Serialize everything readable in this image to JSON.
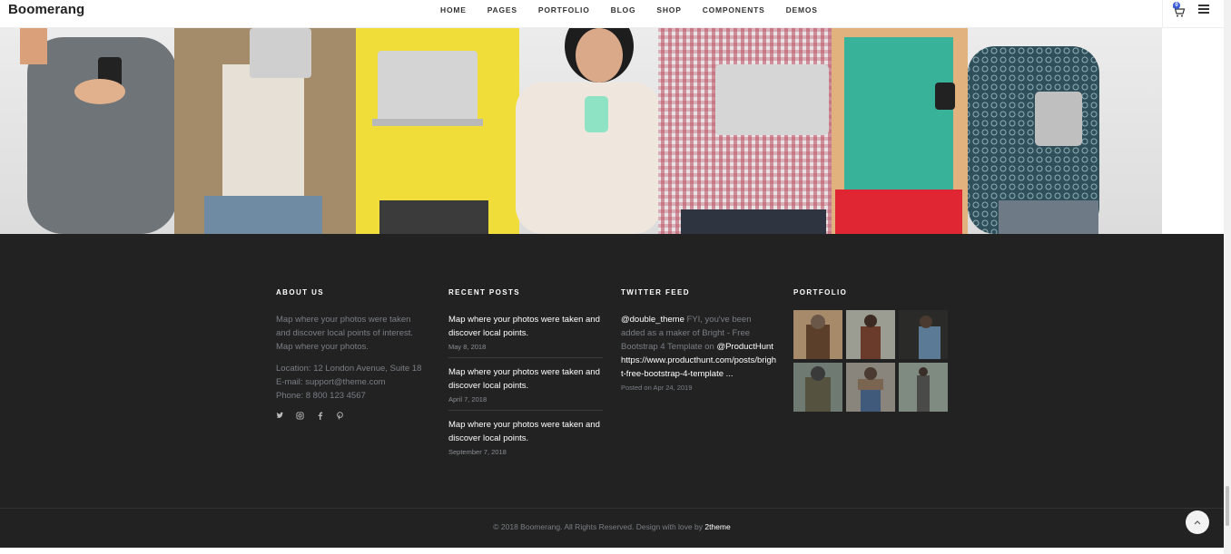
{
  "header": {
    "logo": "Boomerang",
    "nav": [
      "HOME",
      "PAGES",
      "PORTFOLIO",
      "BLOG",
      "SHOP",
      "COMPONENTS",
      "DEMOS"
    ],
    "cart_count": "0"
  },
  "about": {
    "heading": "ABOUT US",
    "text": "Map where your photos were taken and discover local points of interest. Map where your photos.",
    "location": "Location: 12 London Avenue, Suite 18",
    "email": "E-mail: support@theme.com",
    "phone": "Phone: 8 800 123 4567",
    "social_icons": [
      "twitter-icon",
      "instagram-icon",
      "facebook-icon",
      "pinterest-icon"
    ]
  },
  "recent_posts": {
    "heading": "RECENT POSTS",
    "items": [
      {
        "title": "Map where your photos were taken and discover local points.",
        "date": "May 8, 2018"
      },
      {
        "title": "Map where your photos were taken and discover local points.",
        "date": "April 7, 2018"
      },
      {
        "title": "Map where your photos were taken and discover local points.",
        "date": "September 7, 2018"
      }
    ]
  },
  "twitter": {
    "heading": "TWITTER FEED",
    "handle": "@double_theme",
    "text": " FYI, you've been added as a maker of Bright - Free Bootstrap 4 Template on ",
    "mention": "@ProductHunt",
    "link": "https://www.producthunt.com/posts/bright-free-bootstrap-4-template ...",
    "date": "Posted on Apr 24, 2019"
  },
  "portfolio": {
    "heading": "PORTFOLIO"
  },
  "footer": {
    "copyright": "© 2018 Boomerang. All Rights Reserved. Design with love by ",
    "author": "2theme"
  },
  "colors": {
    "footer_bg": "#222222",
    "accent": "#3a5bd9"
  }
}
